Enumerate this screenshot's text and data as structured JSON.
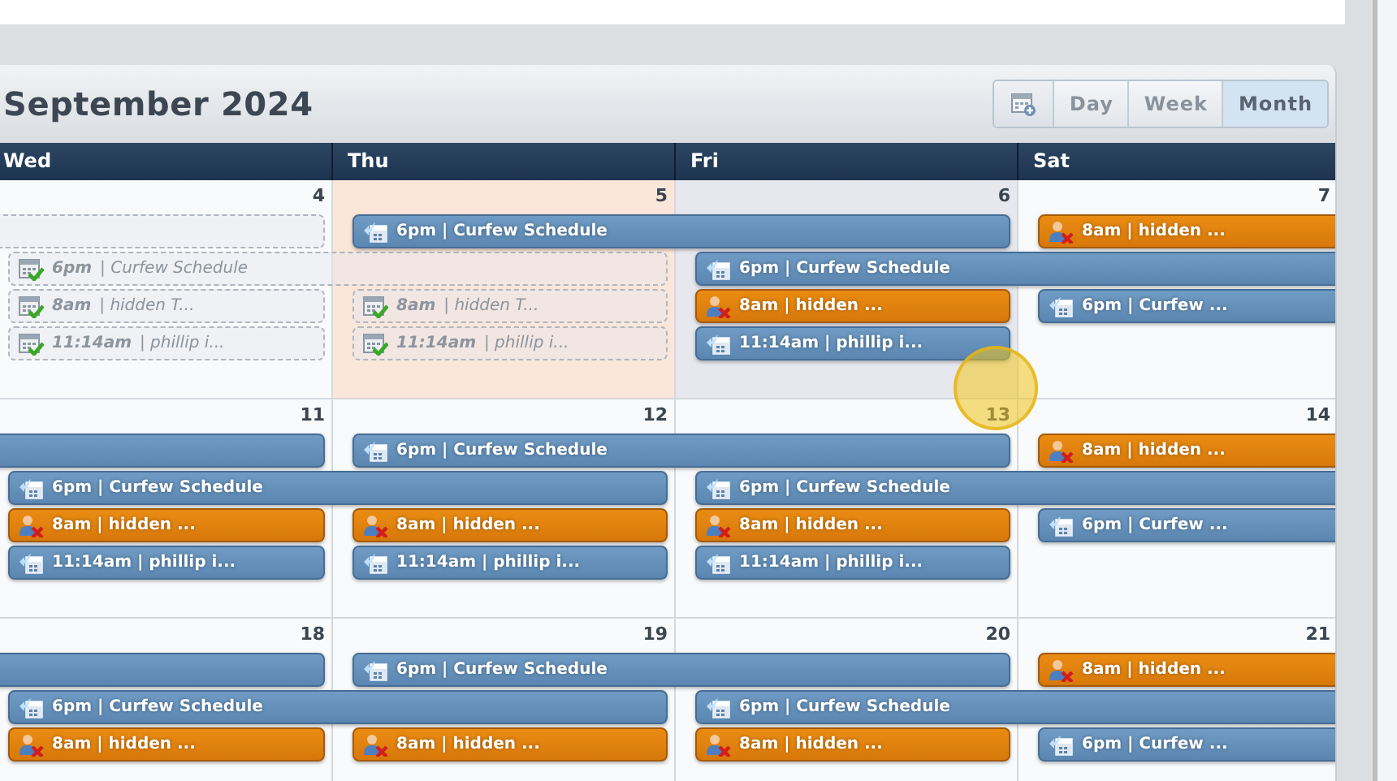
{
  "calendar": {
    "title": "September 2024",
    "view_buttons": [
      {
        "label": "Day",
        "selected": false
      },
      {
        "label": "Week",
        "selected": false
      },
      {
        "label": "Month",
        "selected": true
      }
    ],
    "days": [
      "Wed",
      "Thu",
      "Fri",
      "Sat"
    ],
    "weeks": [
      {
        "cells": [
          {
            "date": "4",
            "color": "#f8fafb"
          },
          {
            "date": "5",
            "color": "#fbe6da"
          },
          {
            "date": "6",
            "color": "#e6e8ee"
          },
          {
            "date": "7",
            "color": "#f8fafb"
          }
        ],
        "lanes": [
          [
            {
              "kind": "done",
              "from_left": true,
              "to_right": false
            },
            {
              "kind": "appointment",
              "from_left": false,
              "to_right": false,
              "text": "6pm | Curfew Schedule"
            },
            {
              "kind": "continued"
            },
            {
              "kind": "absence",
              "from_left": false,
              "to_right": true,
              "text": "8am | hidden ..."
            }
          ],
          [
            {
              "kind": "done",
              "from_left": false,
              "to_right": false,
              "text": "**6pm** | Curfew Schedule"
            },
            {
              "kind": "continued"
            },
            {
              "kind": "appointment",
              "from_left": false,
              "to_right": true,
              "text": "6pm | Curfew Schedule"
            },
            {
              "kind": "continued"
            }
          ],
          [
            {
              "kind": "done",
              "from_left": false,
              "to_right": false,
              "text": "**8am** | hidden T..."
            },
            {
              "kind": "done",
              "from_left": false,
              "to_right": false,
              "text": "**8am** | hidden T..."
            },
            {
              "kind": "absence",
              "from_left": false,
              "to_right": false,
              "text": "8am | hidden ..."
            },
            {
              "kind": "appointment",
              "from_left": false,
              "to_right": true,
              "text": "6pm | Curfew ..."
            }
          ],
          [
            {
              "kind": "done",
              "from_left": false,
              "to_right": false,
              "text": "**11:14am** | phillip i..."
            },
            {
              "kind": "done",
              "from_left": false,
              "to_right": false,
              "text": "**11:14am** | phillip i..."
            },
            {
              "kind": "appointment",
              "from_left": false,
              "to_right": false,
              "text": "11:14am | phillip i..."
            },
            {
              "kind": "empty"
            }
          ]
        ]
      },
      {
        "cells": [
          {
            "date": "11",
            "color": "#f8fafb"
          },
          {
            "date": "12",
            "color": "#f8fafb"
          },
          {
            "date": "13",
            "color": "#f8fafb"
          },
          {
            "date": "14",
            "color": "#f8fafb"
          }
        ],
        "lanes": [
          [
            {
              "kind": "appointment",
              "from_left": true,
              "to_right": false
            },
            {
              "kind": "appointment",
              "from_left": false,
              "to_right": false,
              "text": "6pm | Curfew Schedule"
            },
            {
              "kind": "continued"
            },
            {
              "kind": "absence",
              "from_left": false,
              "to_right": true,
              "text": "8am | hidden ..."
            }
          ],
          [
            {
              "kind": "appointment",
              "from_left": false,
              "to_right": false,
              "text": "6pm | Curfew Schedule"
            },
            {
              "kind": "continued"
            },
            {
              "kind": "appointment",
              "from_left": false,
              "to_right": true,
              "text": "6pm | Curfew Schedule"
            },
            {
              "kind": "continued"
            }
          ],
          [
            {
              "kind": "absence",
              "from_left": false,
              "to_right": false,
              "text": "8am | hidden ..."
            },
            {
              "kind": "absence",
              "from_left": false,
              "to_right": false,
              "text": "8am | hidden ..."
            },
            {
              "kind": "absence",
              "from_left": false,
              "to_right": false,
              "text": "8am | hidden ..."
            },
            {
              "kind": "appointment",
              "from_left": false,
              "to_right": true,
              "text": "6pm | Curfew ..."
            }
          ],
          [
            {
              "kind": "appointment",
              "from_left": false,
              "to_right": false,
              "text": "11:14am | phillip i..."
            },
            {
              "kind": "appointment",
              "from_left": false,
              "to_right": false,
              "text": "11:14am | phillip i..."
            },
            {
              "kind": "appointment",
              "from_left": false,
              "to_right": false,
              "text": "11:14am | phillip i..."
            },
            {
              "kind": "empty"
            }
          ]
        ]
      },
      {
        "cells": [
          {
            "date": "18",
            "color": "#f8fafb"
          },
          {
            "date": "19",
            "color": "#f8fafb"
          },
          {
            "date": "20",
            "color": "#f8fafb"
          },
          {
            "date": "21",
            "color": "#f8fafb"
          }
        ],
        "lanes": [
          [
            {
              "kind": "appointment",
              "from_left": true,
              "to_right": false
            },
            {
              "kind": "appointment",
              "from_left": false,
              "to_right": false,
              "text": "6pm | Curfew Schedule"
            },
            {
              "kind": "continued"
            },
            {
              "kind": "absence",
              "from_left": false,
              "to_right": true,
              "text": "8am | hidden ..."
            }
          ],
          [
            {
              "kind": "appointment",
              "from_left": false,
              "to_right": false,
              "text": "6pm | Curfew Schedule"
            },
            {
              "kind": "continued"
            },
            {
              "kind": "appointment",
              "from_left": false,
              "to_right": true,
              "text": "6pm | Curfew Schedule"
            },
            {
              "kind": "continued"
            }
          ],
          [
            {
              "kind": "absence",
              "from_left": false,
              "to_right": false,
              "text": "8am | hidden ..."
            },
            {
              "kind": "absence",
              "from_left": false,
              "to_right": false,
              "text": "8am | hidden ..."
            },
            {
              "kind": "absence",
              "from_left": false,
              "to_right": false,
              "text": "8am | hidden ..."
            },
            {
              "kind": "appointment",
              "from_left": false,
              "to_right": true,
              "text": "6pm | Curfew ..."
            }
          ]
        ]
      }
    ]
  }
}
